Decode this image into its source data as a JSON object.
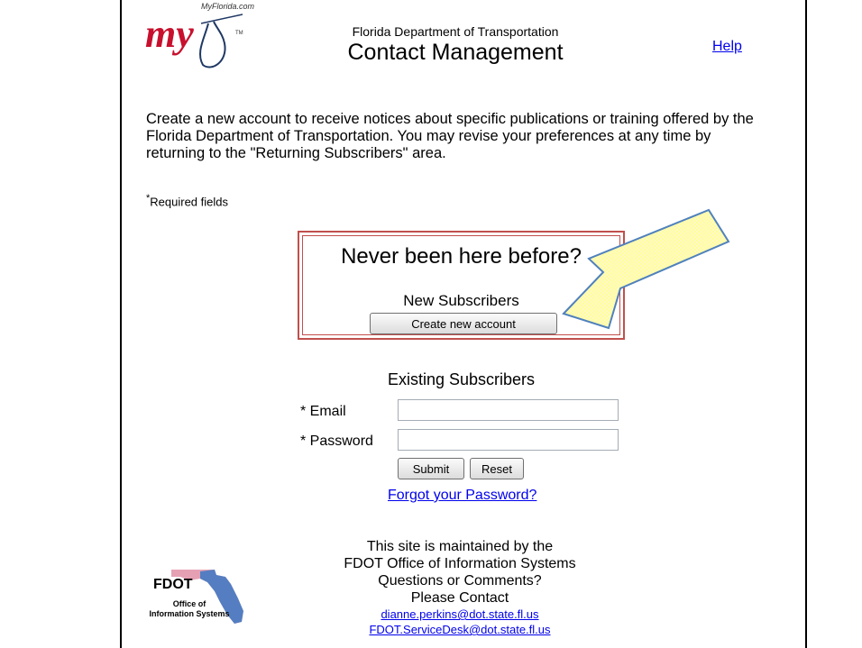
{
  "header": {
    "logo_site": "MyFlorida.com",
    "department": "Florida Department of Transportation",
    "title": "Contact Management",
    "help_link": "Help"
  },
  "intro": {
    "text": "Create a new account to receive notices about specific publications or training offered by the Florida Department of Transportation. You may revise your preferences at any time by returning to the \"Returning Subscribers\" area."
  },
  "required_note": {
    "asterisk": "*",
    "text": "Required fields"
  },
  "new_subscribers": {
    "headline": "Never been here before?",
    "label": "New Subscribers",
    "button": "Create new account"
  },
  "existing_subscribers": {
    "label": "Existing Subscribers",
    "email_label": "* Email",
    "email_value": "",
    "password_label": "* Password",
    "password_value": "",
    "submit": "Submit",
    "reset": "Reset",
    "forgot": "Forgot your Password?"
  },
  "footer": {
    "line1": "This site is maintained by the",
    "line2": "FDOT Office of Information Systems",
    "line3": "Questions or Comments?",
    "line4": "Please Contact",
    "email1": "dianne.perkins@dot.state.fl.us",
    "email2": "FDOT.ServiceDesk@dot.state.fl.us"
  },
  "fdot_logo": {
    "name": "FDOT",
    "sub1": "Office of",
    "sub2": "Information Systems"
  },
  "colors": {
    "link": "#0000ee",
    "highlight_border": "#c0504d",
    "arrow_fill": "#ffff99",
    "arrow_stroke": "#4f81bd"
  },
  "icons": {
    "callout": "arrow-callout-icon",
    "logo": "myflorida-logo-icon",
    "fdot": "florida-map-icon"
  }
}
